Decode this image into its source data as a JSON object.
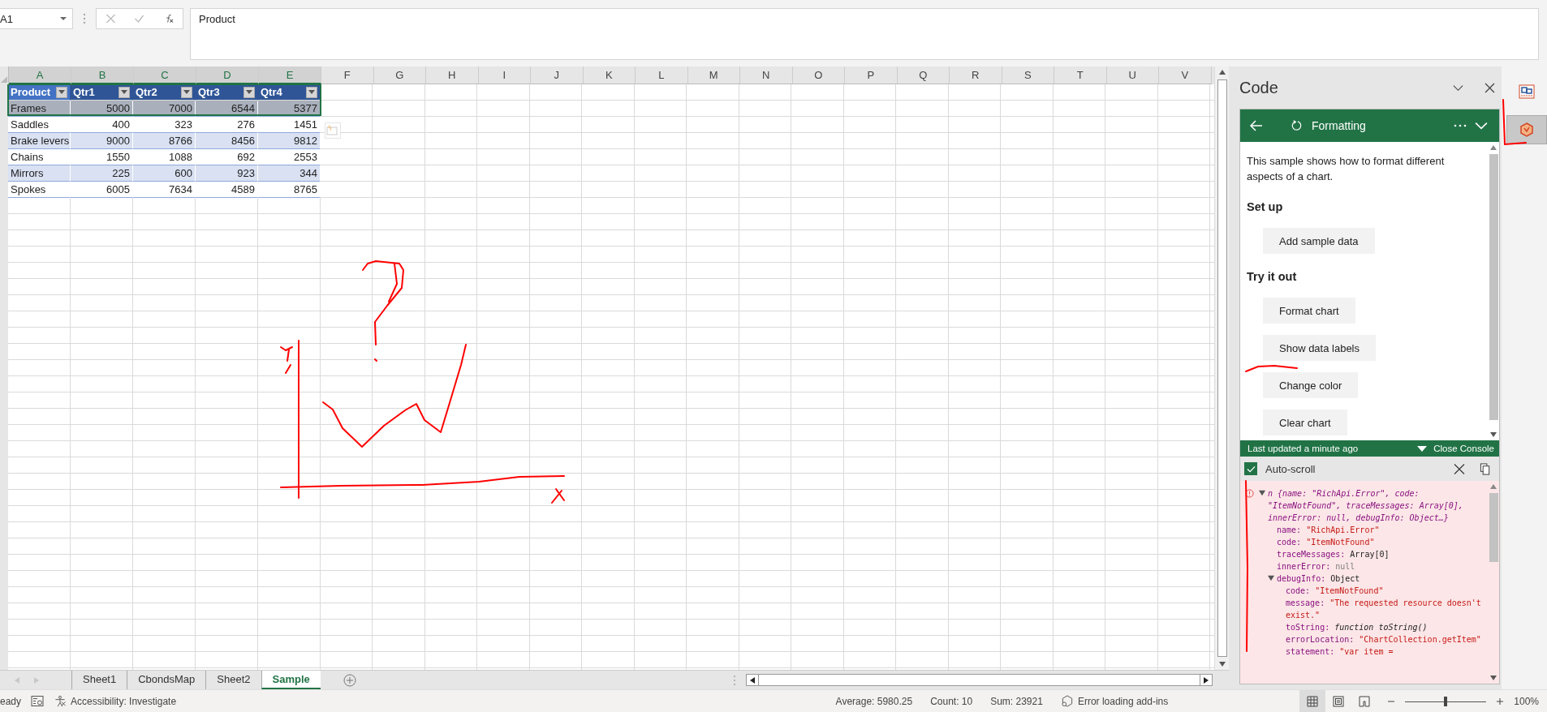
{
  "name_box": {
    "value": "A1"
  },
  "formula_bar": {
    "value": "Product"
  },
  "column_headers": [
    {
      "label": "A",
      "selected": true
    },
    {
      "label": "B",
      "selected": true
    },
    {
      "label": "C",
      "selected": true
    },
    {
      "label": "D",
      "selected": true
    },
    {
      "label": "E",
      "selected": true
    },
    {
      "label": "F",
      "selected": false
    },
    {
      "label": "G",
      "selected": false
    },
    {
      "label": "H",
      "selected": false
    },
    {
      "label": "I",
      "selected": false
    },
    {
      "label": "J",
      "selected": false
    },
    {
      "label": "K",
      "selected": false
    },
    {
      "label": "L",
      "selected": false
    },
    {
      "label": "M",
      "selected": false
    },
    {
      "label": "N",
      "selected": false
    },
    {
      "label": "O",
      "selected": false
    },
    {
      "label": "P",
      "selected": false
    },
    {
      "label": "Q",
      "selected": false
    },
    {
      "label": "R",
      "selected": false
    },
    {
      "label": "S",
      "selected": false
    },
    {
      "label": "T",
      "selected": false
    },
    {
      "label": "U",
      "selected": false
    },
    {
      "label": "V",
      "selected": false
    }
  ],
  "table": {
    "columns": [
      {
        "label": "Product",
        "selected": true
      },
      {
        "label": "Qtr1",
        "selected": false
      },
      {
        "label": "Qtr2",
        "selected": false
      },
      {
        "label": "Qtr3",
        "selected": false
      },
      {
        "label": "Qtr4",
        "selected": false
      }
    ],
    "rows": [
      {
        "cells": [
          "Frames",
          "5000",
          "7000",
          "6544",
          "5377"
        ],
        "selected": true
      },
      {
        "cells": [
          "Saddles",
          "400",
          "323",
          "276",
          "1451"
        ],
        "selected": false
      },
      {
        "cells": [
          "Brake levers",
          "9000",
          "8766",
          "8456",
          "9812"
        ],
        "selected": false
      },
      {
        "cells": [
          "Chains",
          "1550",
          "1088",
          "692",
          "2553"
        ],
        "selected": false
      },
      {
        "cells": [
          "Mirrors",
          "225",
          "600",
          "923",
          "344"
        ],
        "selected": false
      },
      {
        "cells": [
          "Spokes",
          "6005",
          "7634",
          "4589",
          "8765"
        ],
        "selected": false
      }
    ]
  },
  "sheet_tabs": [
    {
      "label": "Sheet1",
      "selected": false
    },
    {
      "label": "CbondsMap",
      "selected": false
    },
    {
      "label": "Sheet2",
      "selected": false
    },
    {
      "label": "Sample",
      "selected": true
    }
  ],
  "task_pane": {
    "title": "Code",
    "header": {
      "title": "Formatting"
    },
    "description": "This sample shows how to format different aspects of a chart.",
    "sections": [
      {
        "heading": "Set up",
        "buttons": [
          "Add sample data"
        ]
      },
      {
        "heading": "Try it out",
        "buttons": [
          "Format chart",
          "Show data labels",
          "Change color",
          "Clear chart"
        ]
      }
    ],
    "console_bar": {
      "status": "Last updated a minute ago",
      "toggle": "Close Console"
    },
    "auto_scroll": {
      "label": "Auto-scroll",
      "checked": true
    },
    "console": [
      {
        "summary": "n {name: \"RichApi.Error\", code: \"ItemNotFound\", traceMessages: Array[0], innerError: null, debugInfo: Object…}",
        "expanded": true,
        "children": [
          {
            "key": "name:",
            "value": "\"RichApi.Error\"",
            "kind": "string"
          },
          {
            "key": "code:",
            "value": "\"ItemNotFound\"",
            "kind": "string"
          },
          {
            "key": "traceMessages:",
            "value": "Array[0]",
            "kind": "object"
          },
          {
            "key": "innerError:",
            "value": "null",
            "kind": "null"
          },
          {
            "key": "debugInfo:",
            "value": "Object",
            "kind": "object",
            "expanded": true,
            "children": [
              {
                "key": "code:",
                "value": "\"ItemNotFound\"",
                "kind": "string"
              },
              {
                "key": "message:",
                "value": "\"The requested resource doesn't exist.\"",
                "kind": "string"
              },
              {
                "key": "toString:",
                "value": "function toString()",
                "kind": "function"
              },
              {
                "key": "errorLocation:",
                "value": "\"ChartCollection.getItem\"",
                "kind": "string"
              },
              {
                "key": "statement:",
                "value": "\"var item =",
                "kind": "string"
              }
            ]
          }
        ]
      }
    ]
  },
  "side_icons": [
    {
      "selected": false
    },
    {
      "selected": true
    }
  ],
  "status_bar": {
    "mode": "eady",
    "accessibility": "Accessibility: Investigate",
    "average": "Average: 5980.25",
    "count": "Count: 10",
    "sum": "Sum: 23921",
    "addins": "Error loading add-ins",
    "view_buttons": [
      {
        "selected": true
      },
      {
        "selected": false
      },
      {
        "selected": false
      }
    ],
    "zoom": {
      "level": 0.5,
      "reading": "100%"
    }
  }
}
